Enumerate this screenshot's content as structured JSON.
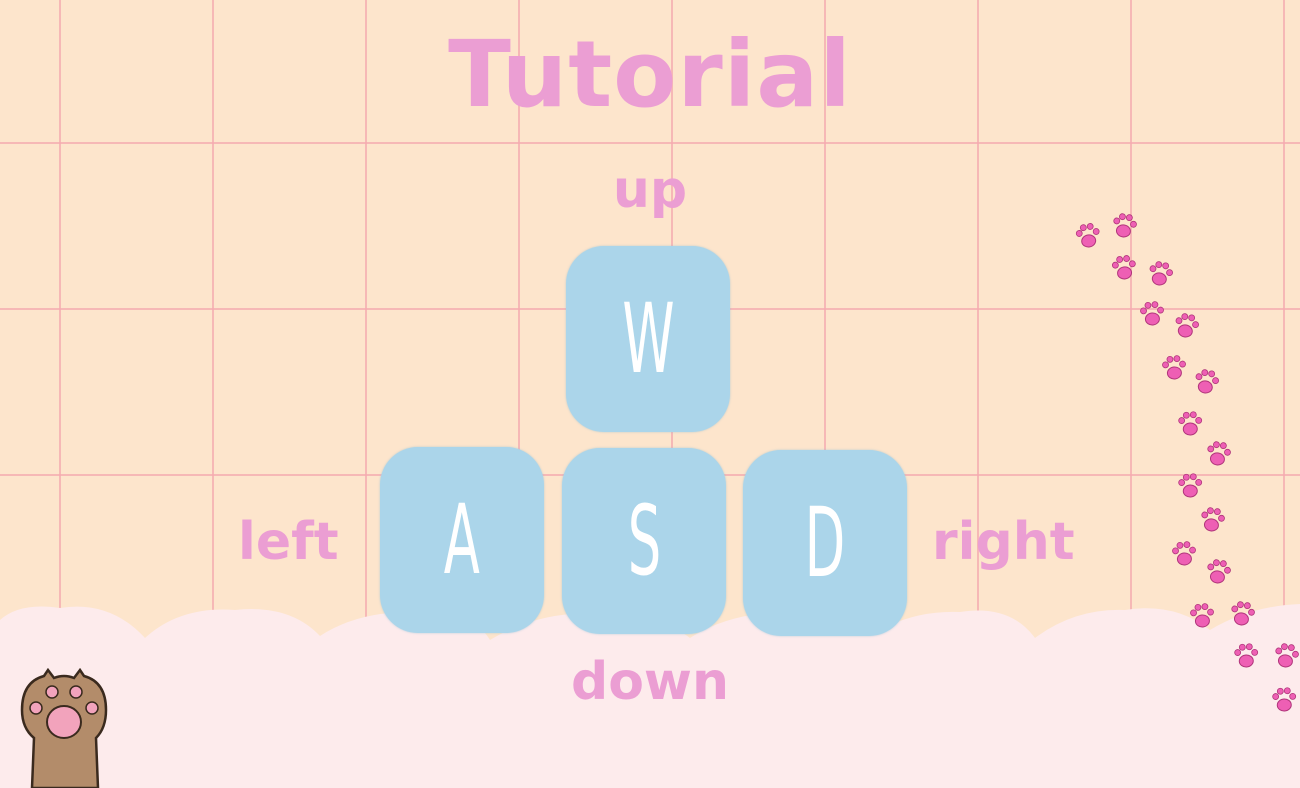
{
  "title": "Tutorial",
  "directions": {
    "up": "up",
    "left": "left",
    "right": "right",
    "down": "down"
  },
  "keys": {
    "w": "W",
    "a": "A",
    "s": "S",
    "d": "D"
  },
  "icons": {
    "paw_trail": "paw-print-icon",
    "cat_paw": "cat-paw-icon"
  },
  "colors": {
    "background": "#fde5cc",
    "grid_line": "#f5aaaf",
    "title_text": "#eb9ed3",
    "key_fill": "#abd5ea",
    "key_letter": "#ffffff",
    "cloud_floor": "#fdebec",
    "paw_print": "#ee5fb4",
    "cat_paw_fur": "#b38c6a",
    "cat_paw_pad": "#f2a3bc"
  }
}
